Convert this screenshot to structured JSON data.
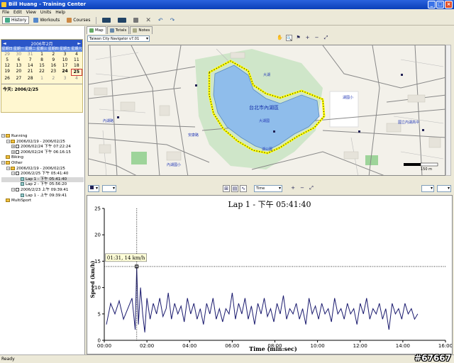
{
  "window": {
    "title": "Bill Huang - Training Center",
    "min": "_",
    "max": "□",
    "close": "×"
  },
  "menu": [
    "File",
    "Edit",
    "View",
    "Units",
    "Help"
  ],
  "toolbar": {
    "history": "History",
    "workouts": "Workouts",
    "courses": "Courses"
  },
  "calendar": {
    "month_label": "2006年2月",
    "prev": "◄",
    "next": "►",
    "weekdays": [
      "星期日",
      "星期一",
      "星期二",
      "星期三",
      "星期四",
      "星期五",
      "星期六"
    ],
    "days": [
      "29",
      "30",
      "31",
      "1",
      "2",
      "3",
      "4",
      "5",
      "6",
      "7",
      "8",
      "9",
      "10",
      "11",
      "12",
      "13",
      "14",
      "15",
      "16",
      "17",
      "18",
      "19",
      "20",
      "21",
      "22",
      "23",
      "24",
      "25",
      "26",
      "27",
      "28",
      "1",
      "2",
      "3",
      "4"
    ],
    "today": "今天: 2006/2/25"
  },
  "tree": [
    {
      "label": "Running",
      "level": 0,
      "type": "folder",
      "exp": "−"
    },
    {
      "label": "2006/02/19 - 2006/02/25",
      "level": 1,
      "type": "folder",
      "exp": "−"
    },
    {
      "label": "2006/02/24 下午 07:22:24",
      "level": 2,
      "type": "run",
      "exp": "+"
    },
    {
      "label": "2006/02/24 下午 06:16:15",
      "level": 2,
      "type": "run",
      "exp": "+"
    },
    {
      "label": "Biking",
      "level": 0,
      "type": "folder",
      "exp": ""
    },
    {
      "label": "Other",
      "level": 0,
      "type": "folder",
      "exp": "−"
    },
    {
      "label": "2006/02/19 - 2006/02/25",
      "level": 1,
      "type": "folder",
      "exp": "−"
    },
    {
      "label": "2006/2/25 下午 05:41:40",
      "level": 2,
      "type": "run",
      "exp": "−"
    },
    {
      "label": "Lap 1 - 下午 05:41:40",
      "level": 3,
      "type": "lap",
      "exp": "",
      "selected": true
    },
    {
      "label": "Lap 2 - 下午 05:56:20",
      "level": 3,
      "type": "lap",
      "exp": ""
    },
    {
      "label": "2006/2/23 上午 09:39:41",
      "level": 2,
      "type": "run",
      "exp": "−"
    },
    {
      "label": "Lap 1 - 上午 09:39:41",
      "level": 3,
      "type": "lap",
      "exp": ""
    },
    {
      "label": "MultiSport",
      "level": 0,
      "type": "folder",
      "exp": ""
    }
  ],
  "map": {
    "tabs": [
      "Map",
      "Totals",
      "Notes"
    ],
    "layer": "Taiwan City Navigator v7.01",
    "scale": "150 m",
    "tools": [
      "✋",
      "🔍",
      "⚑",
      "+",
      "−",
      "⤢"
    ],
    "labels": {
      "lake_name": "台北市內湖區",
      "place1": "大湖國",
      "place2": "湖公園",
      "place3": "內湖國小",
      "place4": "國立內湖高中",
      "place5": "大湖",
      "place6": "湖國小",
      "place7": "內湖路",
      "place8": "安康路"
    }
  },
  "chart_toolbar": {
    "x_axis_select": "Time",
    "y_select": "",
    "right_select": ""
  },
  "chart_data": {
    "type": "line",
    "title": "Lap 1 - 下午 05:41:40",
    "xlabel": "Time (min:sec)",
    "ylabel": "Speed (km/h)",
    "ylim": [
      0,
      25
    ],
    "xlim": [
      0,
      16
    ],
    "yticks": [
      0,
      5,
      10,
      15,
      20,
      25
    ],
    "xticks": [
      "00:00",
      "02:00",
      "04:00",
      "06:00",
      "08:00",
      "10:00",
      "12:00",
      "14:00",
      "16:00"
    ],
    "annotation": "01:31, 14 km/h",
    "cursor": {
      "x": 1.52,
      "y": 14
    },
    "series": [
      {
        "values": [
          [
            0.1,
            3
          ],
          [
            0.3,
            7
          ],
          [
            0.5,
            5
          ],
          [
            0.7,
            7.5
          ],
          [
            0.9,
            4
          ],
          [
            1.1,
            6
          ],
          [
            1.3,
            8
          ],
          [
            1.45,
            2
          ],
          [
            1.52,
            14
          ],
          [
            1.6,
            3
          ],
          [
            1.7,
            10
          ],
          [
            1.8,
            5
          ],
          [
            1.9,
            1.5
          ],
          [
            2.0,
            8
          ],
          [
            2.15,
            4
          ],
          [
            2.3,
            7
          ],
          [
            2.45,
            5
          ],
          [
            2.6,
            8
          ],
          [
            2.75,
            4.5
          ],
          [
            2.9,
            6
          ],
          [
            3.0,
            9
          ],
          [
            3.15,
            4
          ],
          [
            3.3,
            7
          ],
          [
            3.45,
            5
          ],
          [
            3.6,
            6.5
          ],
          [
            3.75,
            3.5
          ],
          [
            3.9,
            8
          ],
          [
            4.05,
            5
          ],
          [
            4.2,
            7
          ],
          [
            4.35,
            4
          ],
          [
            4.5,
            6
          ],
          [
            4.65,
            3
          ],
          [
            4.8,
            7
          ],
          [
            4.95,
            5
          ],
          [
            5.1,
            8
          ],
          [
            5.25,
            4
          ],
          [
            5.4,
            6
          ],
          [
            5.55,
            3.5
          ],
          [
            5.7,
            6
          ],
          [
            5.85,
            5
          ],
          [
            6.0,
            9
          ],
          [
            6.15,
            4
          ],
          [
            6.3,
            7
          ],
          [
            6.45,
            5
          ],
          [
            6.6,
            8
          ],
          [
            6.75,
            4
          ],
          [
            6.9,
            6.5
          ],
          [
            7.05,
            3
          ],
          [
            7.2,
            7
          ],
          [
            7.35,
            5
          ],
          [
            7.5,
            8
          ],
          [
            7.65,
            4.5
          ],
          [
            7.8,
            6
          ],
          [
            7.95,
            3.5
          ],
          [
            8.1,
            7
          ],
          [
            8.25,
            5
          ],
          [
            8.4,
            8.5
          ],
          [
            8.55,
            4
          ],
          [
            8.7,
            6
          ],
          [
            8.85,
            5
          ],
          [
            9.0,
            7
          ],
          [
            9.15,
            4
          ],
          [
            9.3,
            6
          ],
          [
            9.45,
            3
          ],
          [
            9.6,
            8
          ],
          [
            9.75,
            5
          ],
          [
            9.9,
            6.5
          ],
          [
            10.05,
            4
          ],
          [
            10.2,
            7
          ],
          [
            10.35,
            5
          ],
          [
            10.5,
            6
          ],
          [
            10.65,
            3.5
          ],
          [
            10.8,
            8
          ],
          [
            10.95,
            5
          ],
          [
            11.1,
            6
          ],
          [
            11.25,
            4
          ],
          [
            11.4,
            7
          ],
          [
            11.55,
            5
          ],
          [
            11.7,
            6
          ],
          [
            11.85,
            3
          ],
          [
            12.0,
            7
          ],
          [
            12.15,
            5
          ],
          [
            12.3,
            8
          ],
          [
            12.45,
            4
          ],
          [
            12.6,
            6
          ],
          [
            12.75,
            5
          ],
          [
            12.9,
            7
          ],
          [
            13.05,
            4
          ],
          [
            13.2,
            6
          ],
          [
            13.35,
            2
          ],
          [
            13.5,
            7
          ],
          [
            13.65,
            5
          ],
          [
            13.8,
            6
          ],
          [
            13.95,
            4
          ],
          [
            14.1,
            7
          ],
          [
            14.25,
            5
          ],
          [
            14.4,
            6
          ],
          [
            14.55,
            4
          ],
          [
            14.7,
            5
          ]
        ]
      }
    ]
  },
  "status": "Ready",
  "watermark": "#67667"
}
